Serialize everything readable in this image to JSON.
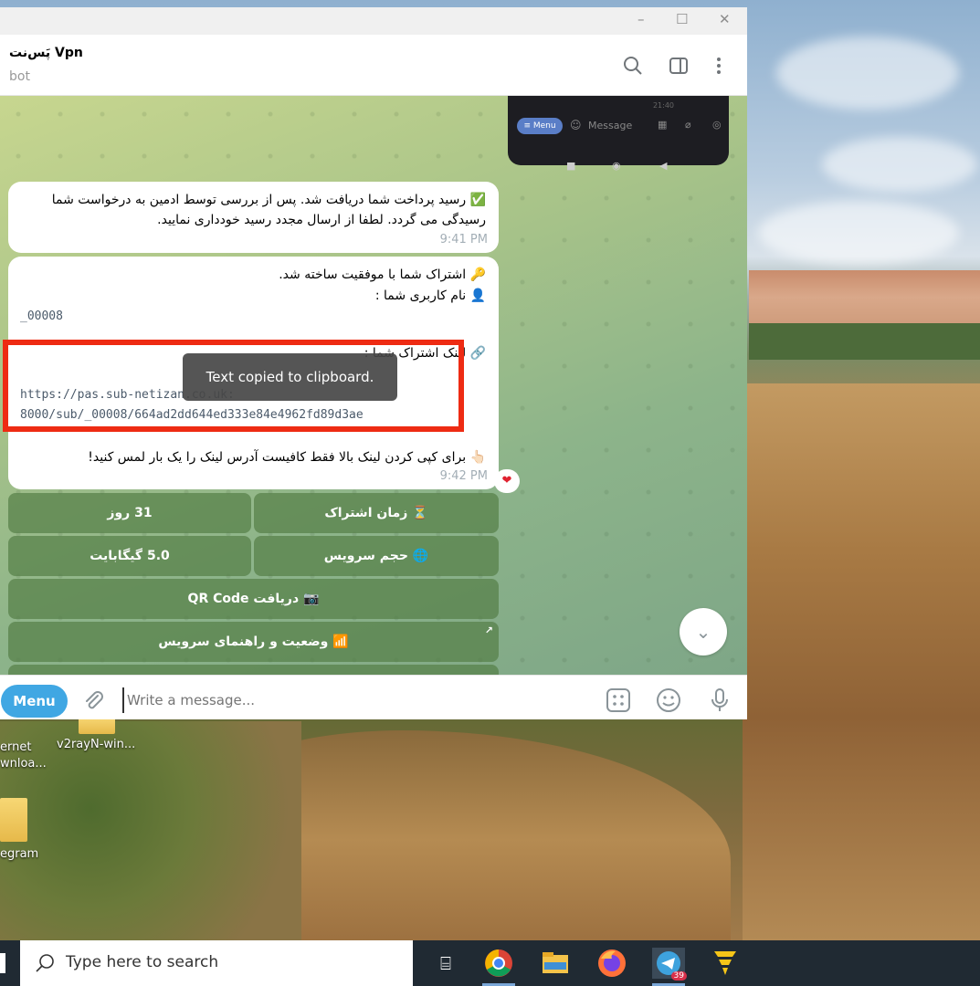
{
  "window": {
    "chat_title": "پَس‌نت Vpn",
    "chat_subtitle": "bot",
    "controls": {
      "minimize": "–",
      "maximize": "☐",
      "close": "✕"
    }
  },
  "preview_phone": {
    "menu_label": "≡ Menu",
    "message_placeholder": "Message",
    "time": "21:40"
  },
  "messages": [
    {
      "lines": [
        "✅ رسید پرداخت شما دریافت شد. پس از بررسی توسط ادمین به درخواست شما",
        "رسیدگی می گردد. لطفا از ارسال مجدد رسید خودداری نمایید."
      ],
      "time": "9:41 PM"
    },
    {
      "lines": [
        "🔑 اشتراک شما با موفقیت ساخته شد.",
        "👤 نام کاربری شما :"
      ],
      "username": "_00008",
      "link_label": "🔗 لینک اشتراک شما :",
      "link_line1": "https://pas.sub-netizan.co.uk:",
      "link_line2": "8000/sub/_00008/664ad2dd644ed333e84e4962fd89d3ae",
      "copy_hint": "👆🏻 برای کپی کردن لینک بالا فقط کافیست آدرس لینک را یک بار لمس کنید!",
      "time": "9:42 PM",
      "reaction": "❤"
    }
  ],
  "toast": "Text copied to clipboard.",
  "keyboard": [
    [
      "⏳ زمان اشتراک",
      "31 روز"
    ],
    [
      "🌐 حجم سرویس",
      "5.0 گیگابایت"
    ],
    [
      "📷 دریافت QR Code"
    ],
    [
      "📶 وضعیت و راهنمای سرویس"
    ]
  ],
  "composer": {
    "menu_label": "Menu",
    "placeholder": "Write a message..."
  },
  "desktop_icons": [
    "ernet\nwnloa...",
    "v2rayN-win...",
    "egram"
  ],
  "taskbar": {
    "search_placeholder": "Type here to search",
    "telegram_badge": "39"
  }
}
